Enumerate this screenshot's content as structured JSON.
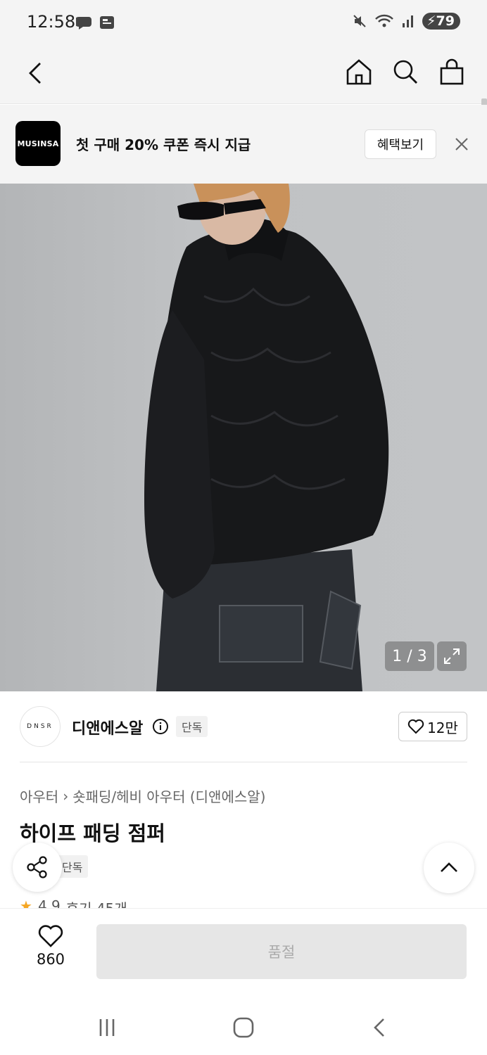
{
  "status_bar": {
    "time": "12:58",
    "battery": "79"
  },
  "banner": {
    "logo_text": "MUSINSA",
    "text": "첫 구매 20% 쿠폰 즉시 지급",
    "benefit_label": "혜택보기"
  },
  "gallery": {
    "counter": "1 / 3"
  },
  "brand": {
    "logo_text": "DNSR",
    "name": "디앤에스알",
    "tag": "단독",
    "like_count": "12만"
  },
  "product": {
    "breadcrumb": [
      "아우터",
      "숏패딩/헤비 아우터 (디앤에스알)"
    ],
    "title": "하이프 패딩 점퍼",
    "tag": "단독",
    "rating": "4.9",
    "reviews": "후기 45개"
  },
  "bottom_bar": {
    "wish_count": "860",
    "purchase_label": "품절"
  },
  "colors": {
    "accent_star": "#f5a623",
    "soldout_bg": "#e6e6e6"
  }
}
